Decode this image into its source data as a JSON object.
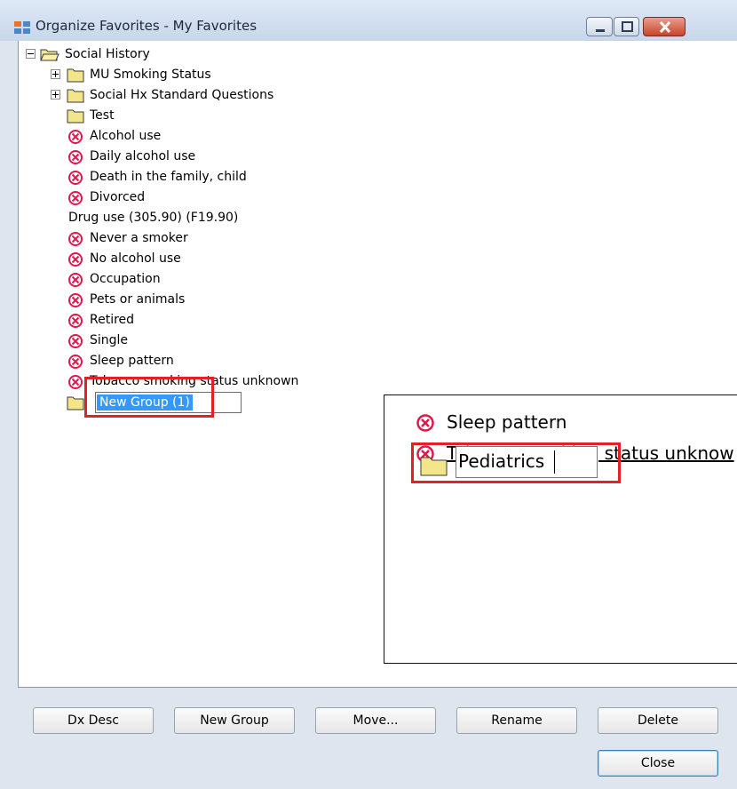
{
  "window": {
    "title": "Organize Favorites - My Favorites",
    "icon": "app-window-icon",
    "controls": [
      "minimize-icon",
      "maximize-icon",
      "close-icon"
    ]
  },
  "tree": {
    "root": {
      "label": "Social History",
      "icon": "open-folder-icon",
      "expander": "collapse-minus-icon"
    },
    "items": [
      {
        "label": "MU Smoking Status",
        "icon": "folder-icon",
        "expander": "expand-plus-icon"
      },
      {
        "label": "Social Hx Standard Questions",
        "icon": "folder-icon",
        "expander": "expand-plus-icon"
      },
      {
        "label": "Test",
        "icon": "folder-icon"
      },
      {
        "label": "Alcohol use",
        "icon": "red-x-circle-icon"
      },
      {
        "label": "Daily alcohol use",
        "icon": "red-x-circle-icon"
      },
      {
        "label": "Death in the family, child",
        "icon": "red-x-circle-icon"
      },
      {
        "label": "Divorced",
        "icon": "red-x-circle-icon"
      },
      {
        "label": "Drug use (305.90) (F19.90)",
        "icon": ""
      },
      {
        "label": "Never a smoker",
        "icon": "red-x-circle-icon"
      },
      {
        "label": "No alcohol use",
        "icon": "red-x-circle-icon"
      },
      {
        "label": "Occupation",
        "icon": "red-x-circle-icon"
      },
      {
        "label": "Pets or animals",
        "icon": "red-x-circle-icon"
      },
      {
        "label": "Retired",
        "icon": "red-x-circle-icon"
      },
      {
        "label": "Single",
        "icon": "red-x-circle-icon"
      },
      {
        "label": "Sleep pattern",
        "icon": "red-x-circle-icon"
      },
      {
        "label": "Tobacco smoking status unknown",
        "icon": "red-x-circle-icon"
      }
    ],
    "new_group": {
      "value": "New Group (1)",
      "icon": "folder-icon"
    }
  },
  "zoom_inset": {
    "items": [
      {
        "label": "Sleep pattern",
        "icon": "red-x-circle-icon"
      },
      {
        "label": "Tobacco smoking status unknow",
        "icon": "red-x-circle-icon"
      }
    ],
    "edit_value": "Pediatrics",
    "edit_icon": "folder-icon"
  },
  "buttons": {
    "dx_desc": "Dx Desc",
    "new_group": "New Group",
    "move": "Move...",
    "rename": "Rename",
    "delete": "Delete",
    "close": "Close"
  },
  "colors": {
    "highlight": "#e32026",
    "selection": "#3399ff",
    "folder": "#f3e58a",
    "error_icon": "#e0184b"
  }
}
